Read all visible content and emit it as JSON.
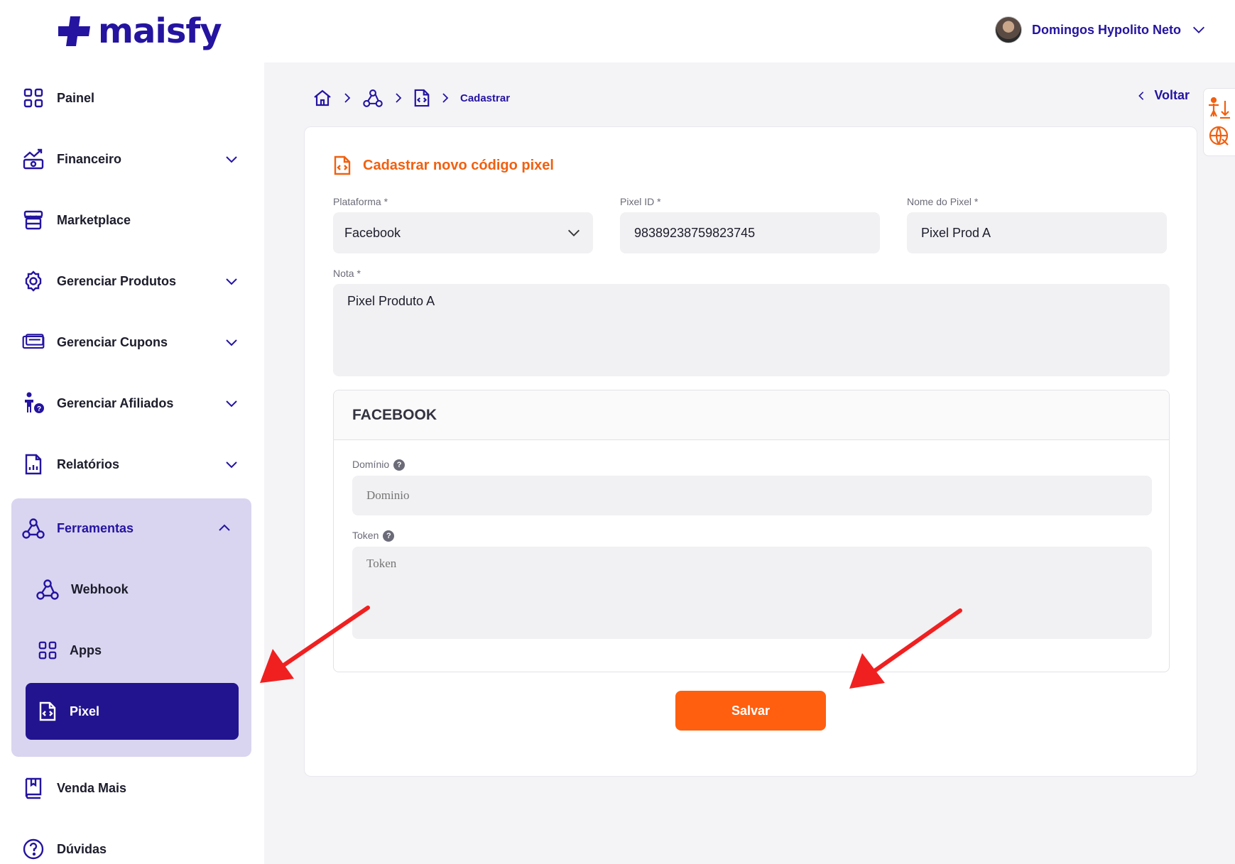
{
  "brand": {
    "name": "maisfy",
    "color": "#2414a0",
    "accent": "#ff5f0f"
  },
  "user": {
    "name": "Domingos Hypolito Neto"
  },
  "sidebar": {
    "items": [
      {
        "label": "Painel",
        "icon": "grid-icon",
        "expandable": false
      },
      {
        "label": "Financeiro",
        "icon": "finance-chart-icon",
        "expandable": true
      },
      {
        "label": "Marketplace",
        "icon": "store-icon",
        "expandable": false
      },
      {
        "label": "Gerenciar Produtos",
        "icon": "gear-icon",
        "expandable": true
      },
      {
        "label": "Gerenciar Cupons",
        "icon": "ticket-icon",
        "expandable": true
      },
      {
        "label": "Gerenciar Afiliados",
        "icon": "affiliate-icon",
        "expandable": true
      },
      {
        "label": "Relatórios",
        "icon": "report-icon",
        "expandable": true
      },
      {
        "label": "Ferramentas",
        "icon": "webhook-icon",
        "expandable": true,
        "expanded": true
      },
      {
        "label": "Venda Mais",
        "icon": "book-icon",
        "expandable": false
      },
      {
        "label": "Dúvidas",
        "icon": "question-icon",
        "expandable": false
      }
    ],
    "tools_subitems": [
      {
        "label": "Webhook",
        "icon": "webhook-icon"
      },
      {
        "label": "Apps",
        "icon": "grid-icon"
      },
      {
        "label": "Pixel",
        "icon": "code-file-icon",
        "active": true
      }
    ]
  },
  "breadcrumb": {
    "current": "Cadastrar"
  },
  "back": {
    "label": "Voltar"
  },
  "form": {
    "title": "Cadastrar novo código pixel",
    "platform": {
      "label": "Plataforma *",
      "value": "Facebook"
    },
    "pixel_id": {
      "label": "Pixel ID *",
      "value": "98389238759823745"
    },
    "pixel_name": {
      "label": "Nome do Pixel *",
      "value": "Pixel Prod A"
    },
    "note": {
      "label": "Nota *",
      "value": "Pixel Produto A"
    },
    "facebook": {
      "title": "FACEBOOK",
      "domain": {
        "label": "Domínio",
        "placeholder": "Dominio"
      },
      "token": {
        "label": "Token",
        "placeholder": "Token"
      }
    },
    "save_label": "Salvar"
  }
}
